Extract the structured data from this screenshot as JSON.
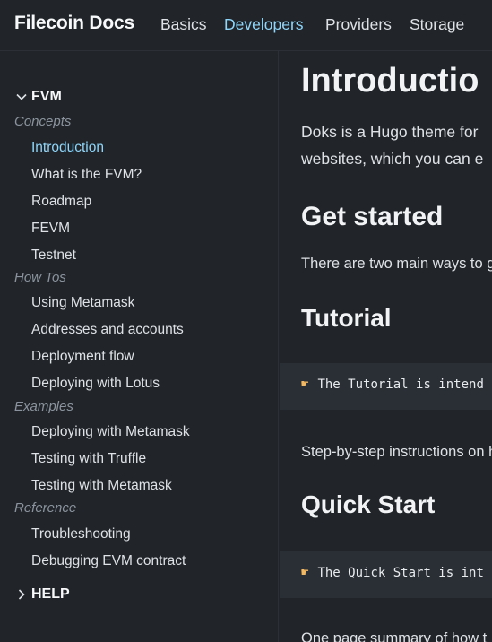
{
  "header": {
    "brand": "Filecoin Docs",
    "nav": [
      "Basics",
      "Developers",
      "Providers",
      "Storage"
    ],
    "active_nav": "Developers"
  },
  "sidebar": {
    "section_fvm": "FVM",
    "categories": {
      "concepts": "Concepts",
      "how_tos": "How Tos",
      "examples": "Examples",
      "reference": "Reference"
    },
    "concepts_items": [
      "Introduction",
      "What is the FVM?",
      "Roadmap",
      "FEVM",
      "Testnet"
    ],
    "howtos_items": [
      "Using Metamask",
      "Addresses and accounts",
      "Deployment flow",
      "Deploying with Lotus"
    ],
    "examples_items": [
      "Deploying with Metamask",
      "Testing with Truffle",
      "Testing with Metamask"
    ],
    "reference_items": [
      "Troubleshooting",
      "Debugging EVM contract"
    ],
    "section_help": "HELP"
  },
  "main": {
    "title": "Introductio",
    "intro_line1": "Doks is a Hugo theme for",
    "intro_line2": "websites, which you can e",
    "get_started": "Get started",
    "get_started_text": "There are two main ways to g",
    "tutorial": "Tutorial",
    "tutorial_callout": "The Tutorial is intend",
    "tutorial_text": "Step-by-step instructions on h",
    "quick_start": "Quick Start",
    "quick_start_callout": "The Quick Start is int",
    "quick_start_text": "One page summary of how t"
  },
  "colors": {
    "background": "#212529",
    "accent": "#8ed6fb",
    "callout_bg": "#2a2f35"
  }
}
